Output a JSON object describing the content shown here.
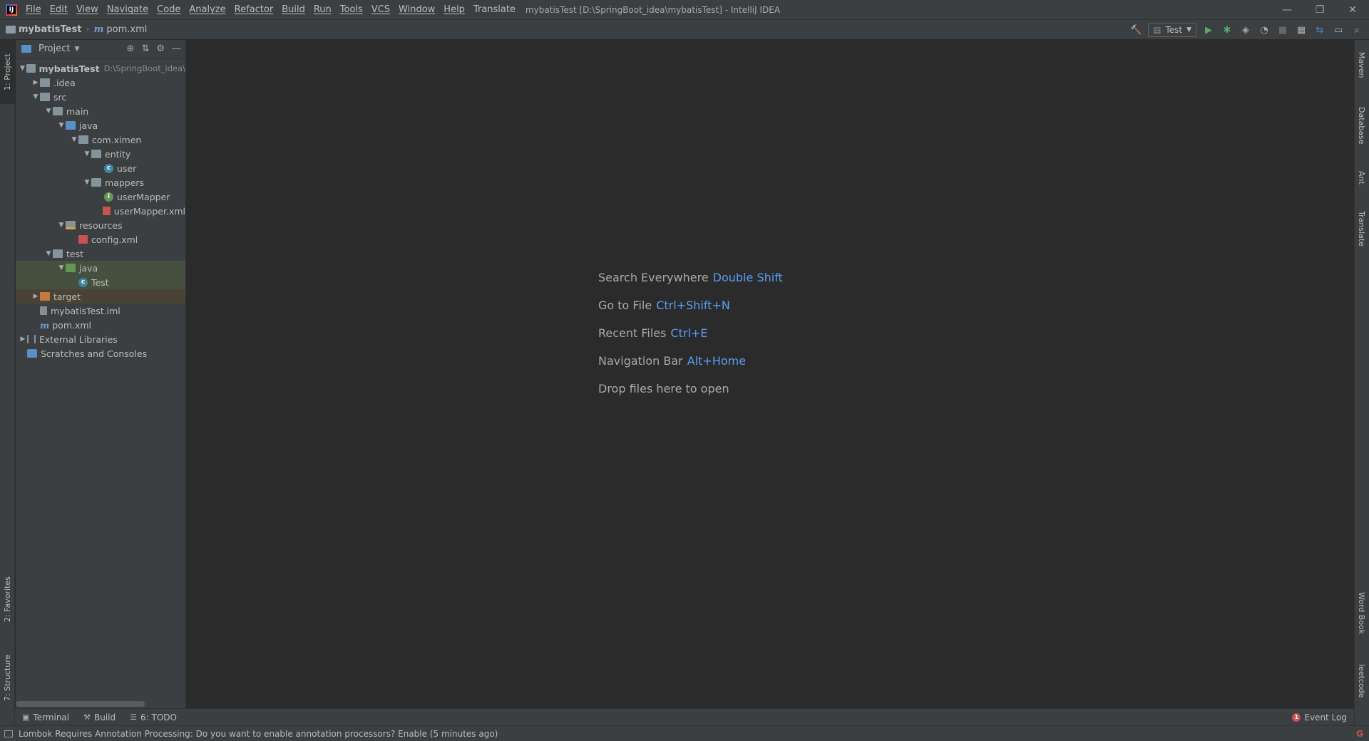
{
  "window": {
    "title": "mybatisTest [D:\\SpringBoot_idea\\mybatisTest] - IntelliJ IDEA",
    "app_icon_letter": "IJ"
  },
  "menu": [
    "File",
    "Edit",
    "View",
    "Navigate",
    "Code",
    "Analyze",
    "Refactor",
    "Build",
    "Run",
    "Tools",
    "VCS",
    "Window",
    "Help",
    "Translate"
  ],
  "breadcrumb": {
    "project": "mybatisTest",
    "file": "pom.xml"
  },
  "toolbar": {
    "run_config": "Test"
  },
  "left_tabs": {
    "project": "1: Project",
    "favorites": "2: Favorites",
    "structure": "7: Structure"
  },
  "right_tabs": {
    "maven": "Maven",
    "database": "Database",
    "ant": "Ant",
    "translate": "Translate",
    "wordbook": "Word Book",
    "leetcode": "leetcode"
  },
  "project_panel": {
    "title": "Project",
    "tree": [
      {
        "label": "mybatisTest",
        "path": "D:\\SpringBoot_idea\\",
        "depth": 0,
        "arrow": "▼",
        "icon": "folder",
        "bold": true
      },
      {
        "label": ".idea",
        "depth": 1,
        "arrow": "▶",
        "icon": "folder"
      },
      {
        "label": "src",
        "depth": 1,
        "arrow": "▼",
        "icon": "folder"
      },
      {
        "label": "main",
        "depth": 2,
        "arrow": "▼",
        "icon": "folder"
      },
      {
        "label": "java",
        "depth": 3,
        "arrow": "▼",
        "icon": "src"
      },
      {
        "label": "com.ximen",
        "depth": 4,
        "arrow": "▼",
        "icon": "pkg"
      },
      {
        "label": "entity",
        "depth": 5,
        "arrow": "▼",
        "icon": "pkg"
      },
      {
        "label": "user",
        "depth": 6,
        "arrow": "",
        "icon": "class"
      },
      {
        "label": "mappers",
        "depth": 5,
        "arrow": "▼",
        "icon": "pkg"
      },
      {
        "label": "userMapper",
        "depth": 6,
        "arrow": "",
        "icon": "iface"
      },
      {
        "label": "userMapper.xml",
        "depth": 6,
        "arrow": "",
        "icon": "xml"
      },
      {
        "label": "resources",
        "depth": 3,
        "arrow": "▼",
        "icon": "res"
      },
      {
        "label": "config.xml",
        "depth": 4,
        "arrow": "",
        "icon": "xml"
      },
      {
        "label": "test",
        "depth": 2,
        "arrow": "▼",
        "icon": "folder"
      },
      {
        "label": "java",
        "depth": 3,
        "arrow": "▼",
        "icon": "test",
        "hl": "green"
      },
      {
        "label": "Test",
        "depth": 4,
        "arrow": "",
        "icon": "class",
        "hl": "green"
      },
      {
        "label": "target",
        "depth": 1,
        "arrow": "▶",
        "icon": "target",
        "hl": "orange"
      },
      {
        "label": "mybatisTest.iml",
        "depth": 1,
        "arrow": "",
        "icon": "iml"
      },
      {
        "label": "pom.xml",
        "depth": 1,
        "arrow": "",
        "icon": "m"
      },
      {
        "label": "External Libraries",
        "depth": 0,
        "arrow": "▶",
        "icon": "lib"
      },
      {
        "label": "Scratches and Consoles",
        "depth": 0,
        "arrow": "",
        "icon": "scratch"
      }
    ]
  },
  "editor_hints": [
    {
      "label": "Search Everywhere",
      "key": "Double Shift"
    },
    {
      "label": "Go to File",
      "key": "Ctrl+Shift+N"
    },
    {
      "label": "Recent Files",
      "key": "Ctrl+E"
    },
    {
      "label": "Navigation Bar",
      "key": "Alt+Home"
    },
    {
      "label": "Drop files here to open",
      "key": ""
    }
  ],
  "bottom_tabs": {
    "terminal": "Terminal",
    "build": "Build",
    "todo": "6: TODO",
    "event_log": "Event Log",
    "event_count": "1"
  },
  "status": {
    "message": "Lombok Requires Annotation Processing: Do you want to enable annotation processors? Enable (5 minutes ago)"
  }
}
